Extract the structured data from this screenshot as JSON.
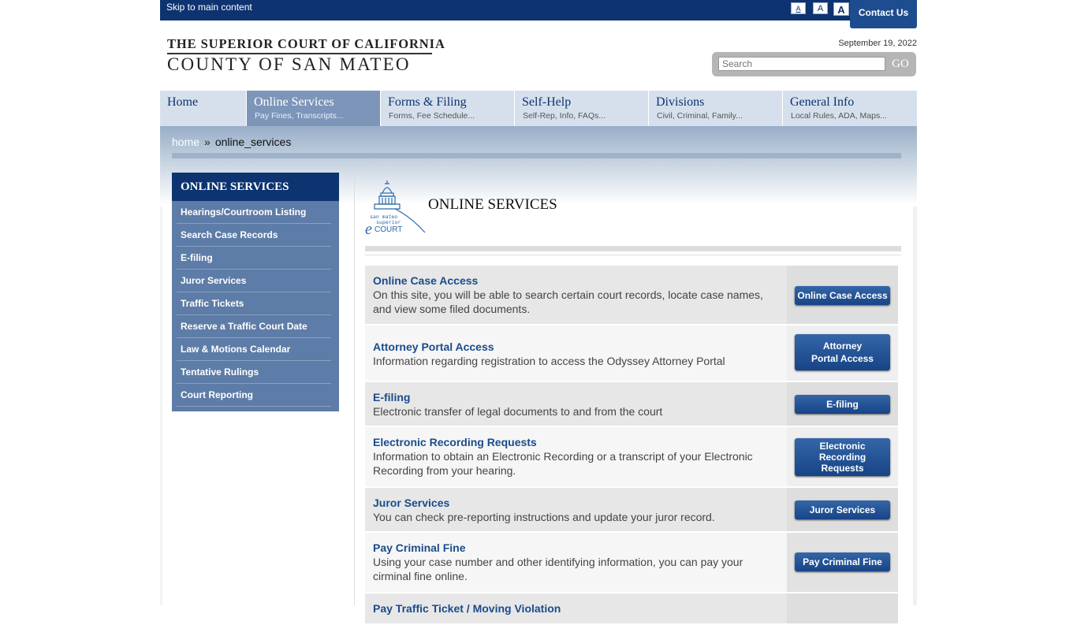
{
  "topbar": {
    "skip_link": "Skip to main content",
    "font_small": "A",
    "font_medium": "A",
    "font_large": "A",
    "contact": "Contact Us"
  },
  "header": {
    "logo_line1": "THE SUPERIOR COURT OF CALIFORNIA",
    "logo_line2": "COUNTY OF SAN MATEO",
    "date": "September 19, 2022",
    "search_placeholder": "Search",
    "go": "GO"
  },
  "nav": [
    {
      "title": "Home",
      "sub": ""
    },
    {
      "title": "Online Services",
      "sub": "Pay Fines, Transcripts..."
    },
    {
      "title": "Forms & Filing",
      "sub": "Forms, Fee Schedule..."
    },
    {
      "title": "Self-Help",
      "sub": "Self-Rep, Info, FAQs..."
    },
    {
      "title": "Divisions",
      "sub": "Civil, Criminal, Family..."
    },
    {
      "title": "General Info",
      "sub": "Local Rules, ADA, Maps..."
    }
  ],
  "breadcrumb": {
    "home": "home",
    "sep": "»",
    "current": "online_services"
  },
  "sidebar": {
    "title": "ONLINE SERVICES",
    "items": [
      "Hearings/Courtroom Listing",
      "Search Case Records",
      "E-filing",
      "Juror Services",
      "Traffic Tickets",
      "Reserve a Traffic Court Date",
      "Law & Motions Calendar",
      "Tentative Rulings",
      "Court Reporting"
    ]
  },
  "logo_ecourt": {
    "line1": "san mateo",
    "line2": "superior",
    "e": "e",
    "court": "COURT"
  },
  "main": {
    "title": "ONLINE SERVICES",
    "services": [
      {
        "name": "Online Case Access",
        "desc": "On this site, you will be able to search certain court records, locate case names, and view some filed documents.",
        "button": "Online Case Access"
      },
      {
        "name": "Attorney Portal Access",
        "desc": "Information regarding registration to access the Odyssey Attorney Portal",
        "button_line1": "Attorney",
        "button_line2": "Portal Access"
      },
      {
        "name": "E-filing",
        "desc": "Electronic transfer of legal documents to and from the court",
        "button": "E-filing"
      },
      {
        "name": "Electronic Recording Requests",
        "desc": "Information to obtain an Electronic Recording or a transcript of your Electronic Recording from your hearing.",
        "button_line1": "Electronic",
        "button_line2": "Recording",
        "button_line3": "Requests"
      },
      {
        "name": "Juror Services",
        "desc": "You can check pre-reporting instructions and update your juror record.",
        "button": "Juror Services"
      },
      {
        "name": "Pay Criminal Fine",
        "desc": "Using your case number and other identifying information, you can pay your cirminal fine online.",
        "button": "Pay Criminal Fine"
      },
      {
        "name": "Pay Traffic Ticket / Moving Violation"
      }
    ]
  }
}
